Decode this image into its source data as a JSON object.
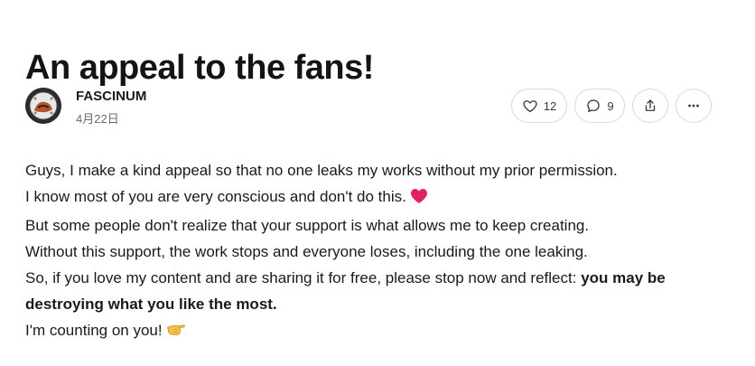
{
  "post": {
    "title": "An appeal to the fans!",
    "author": "FASCINUM",
    "date": "4月22日",
    "likes": "12",
    "comments": "9",
    "paragraphs": [
      "Guys, I make a kind appeal so that no one leaks my works without my prior permission.",
      "I know most of you are very conscious and don't do this.",
      "But some people don't realize that your support is what allows me to keep creating.",
      "Without this support, the work stops and everyone loses, including the one leaking.",
      "So, if you love my content and are sharing it for free, please stop now and reflect:",
      "I'm counting on you!"
    ],
    "emphasis": "you may be destroying what you like the most."
  },
  "icons": {
    "like": "heart-icon",
    "comment": "comment-icon",
    "share": "share-icon",
    "more": "more-icon",
    "heart_emoji": "red-heart-emoji",
    "hand_emoji": "pointing-hand-emoji"
  },
  "colors": {
    "text": "#1a1a1a",
    "muted": "#6b6b6b",
    "border": "#d9d9d9",
    "heart": "#e0245e"
  }
}
